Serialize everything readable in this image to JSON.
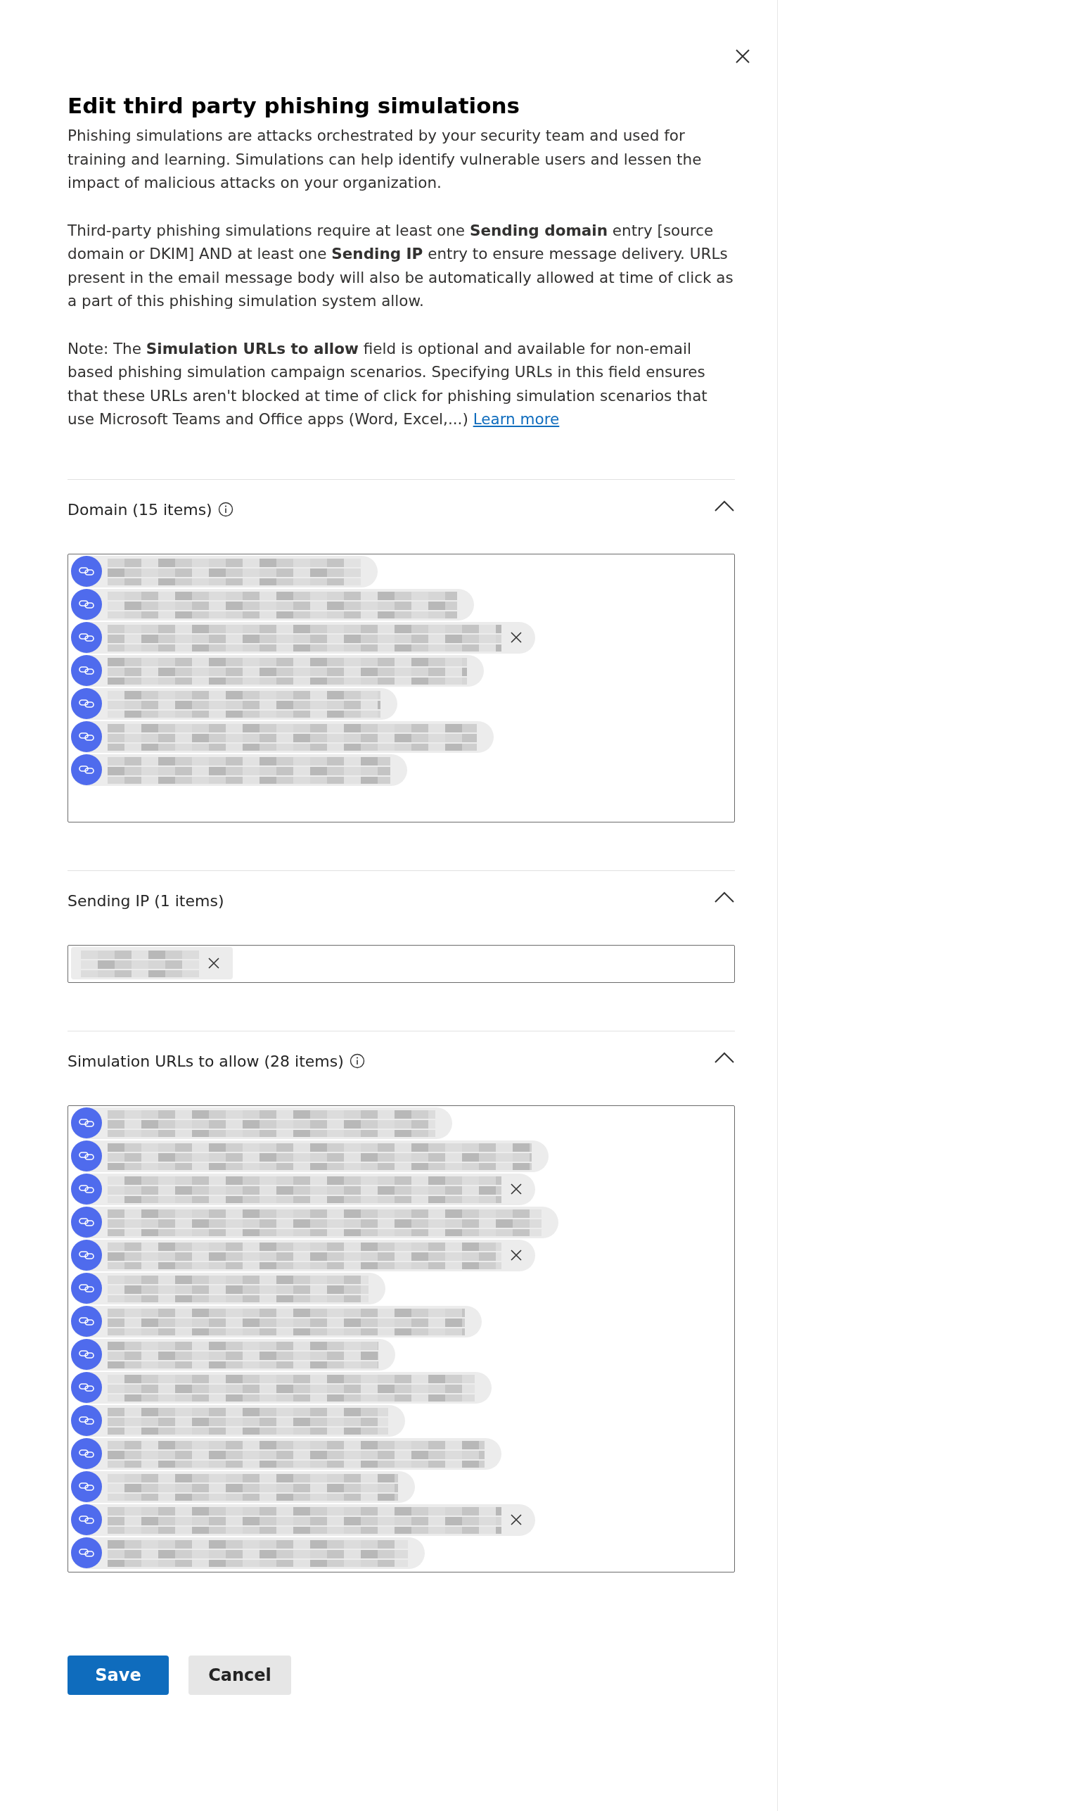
{
  "panel": {
    "title": "Edit third party phishing simulations",
    "paragraphs": [
      "Phishing simulations are attacks orchestrated by your security team and used for training and learning. Simulations can help identify vulnerable users and lessen the impact of malicious attacks on your organization.",
      "Third-party phishing simulations require at least one **Sending domain** entry [source domain or DKIM] AND at least one **Sending IP** entry to ensure message delivery. URLs present in the email message body will also be automatically allowed at time of click as a part of this phishing simulation system allow.",
      "Note: The **Simulation URLs to allow** field is optional and available for non-email based phishing simulation campaign scenarios. Specifying URLs in this field ensures that these URLs aren't blocked at time of click for phishing simulation scenarios that use Microsoft Teams and Office apps (Word, Excel,...)"
    ],
    "learn_more": "Learn more"
  },
  "sections": [
    {
      "title": "Domain (15 items)",
      "info": true,
      "expanded": true,
      "chips": [
        {
          "kind": "link",
          "remove_shown": false
        },
        {
          "kind": "link",
          "remove_shown": false
        },
        {
          "kind": "link",
          "remove_shown": true
        },
        {
          "kind": "link",
          "remove_shown": false
        },
        {
          "kind": "link",
          "remove_shown": false
        },
        {
          "kind": "link",
          "remove_shown": false
        },
        {
          "kind": "link",
          "remove_shown": false
        }
      ]
    },
    {
      "title": "Sending IP (1 items)",
      "info": false,
      "expanded": true,
      "chips": [
        {
          "kind": "plain",
          "remove_shown": true
        }
      ]
    },
    {
      "title": "Simulation URLs to allow (28 items)",
      "info": true,
      "expanded": true,
      "chips": [
        {
          "kind": "link",
          "remove_shown": false
        },
        {
          "kind": "link",
          "remove_shown": false
        },
        {
          "kind": "link",
          "remove_shown": true
        },
        {
          "kind": "link",
          "remove_shown": false
        },
        {
          "kind": "link",
          "remove_shown": true
        },
        {
          "kind": "link",
          "remove_shown": false
        },
        {
          "kind": "link",
          "remove_shown": false
        },
        {
          "kind": "link",
          "remove_shown": false
        },
        {
          "kind": "link",
          "remove_shown": false
        },
        {
          "kind": "link",
          "remove_shown": false
        },
        {
          "kind": "link",
          "remove_shown": false
        },
        {
          "kind": "link",
          "remove_shown": false
        },
        {
          "kind": "link",
          "remove_shown": true
        },
        {
          "kind": "link",
          "remove_shown": false
        }
      ]
    }
  ],
  "buttons": [
    {
      "label": "Save",
      "primary": true
    },
    {
      "label": "Cancel",
      "primary": false
    }
  ]
}
